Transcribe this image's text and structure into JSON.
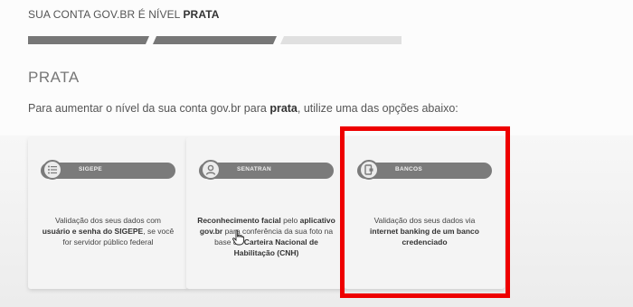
{
  "header": {
    "level_prefix": "SUA CONTA GOV.BR É NÍVEL",
    "level_name": "PRATA"
  },
  "progress": {
    "segments_total": 3,
    "segments_filled": 2
  },
  "section": {
    "title": "PRATA",
    "intro_before": "Para aumentar o nível da sua conta gov.br para",
    "intro_bold": "prata",
    "intro_after": ", utilize uma das opções abaixo:"
  },
  "options": [
    {
      "label": "SIGEPE",
      "icon": "list-icon",
      "desc_1": "Validação dos seus dados com",
      "desc_bold": "usuário e senha do SIGEPE",
      "desc_2": ", se você for servidor público federal"
    },
    {
      "label": "SENATRAN",
      "icon": "face-icon",
      "desc_bold_1": "Reconhecimento facial",
      "desc_1": " pelo",
      "desc_bold_2": "aplicativo gov.br",
      "desc_2": " para conferência da sua foto na base da",
      "desc_bold_3": "Carteira Nacional de Habilitação (CNH)"
    },
    {
      "label": "BANCOS",
      "icon": "bank-icon",
      "desc_1": "Validação dos seus dados via",
      "desc_bold": "internet banking de um banco credenciado"
    }
  ],
  "colors": {
    "highlight": "#ee0000",
    "pill": "#7b7b7b",
    "progress_filled": "#777777",
    "progress_empty": "#e0e0e0"
  }
}
